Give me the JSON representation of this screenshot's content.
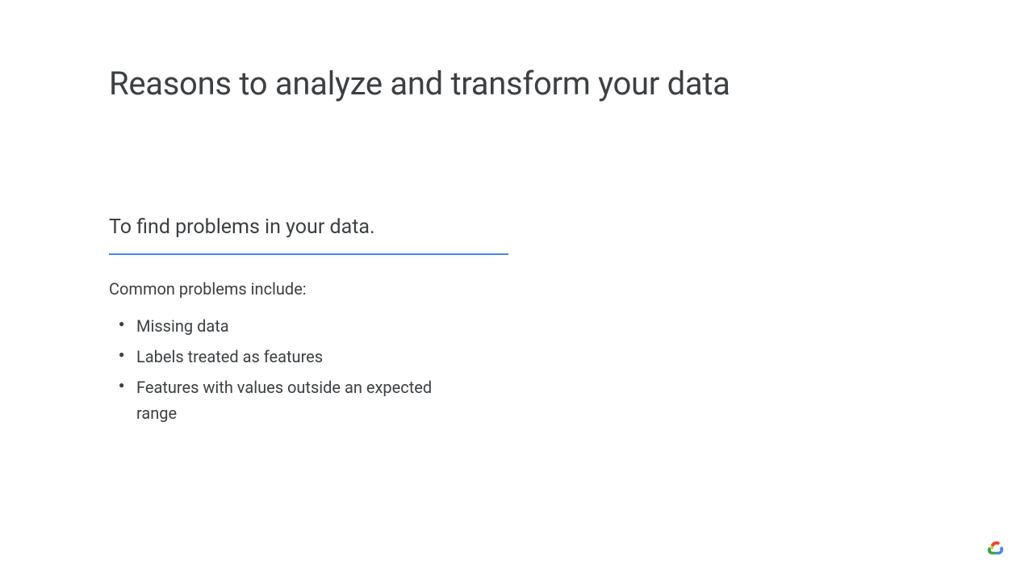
{
  "slide": {
    "title": "Reasons to analyze and transform your data",
    "subtitle": "To find problems in your data.",
    "subheading": "Common problems include:",
    "bullets": [
      "Missing data",
      "Labels treated as features",
      "Features with values outside an expected range"
    ]
  }
}
